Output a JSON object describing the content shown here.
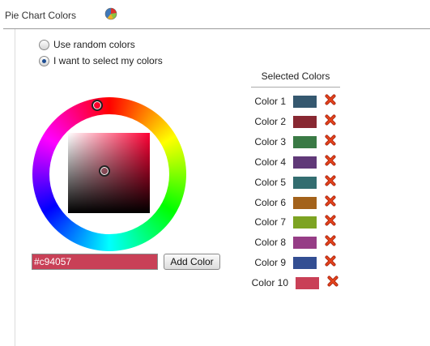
{
  "section": {
    "title": "Pie Chart Colors",
    "icon": "pie-chart-icon"
  },
  "color_mode": {
    "options": [
      {
        "label": "Use random colors",
        "checked": false
      },
      {
        "label": "I want to select my colors",
        "checked": true
      }
    ]
  },
  "picker": {
    "hex_value": "#c94057",
    "add_label": "Add Color"
  },
  "selected": {
    "header": "Selected Colors",
    "remove_icon": "remove-x-icon",
    "items": [
      {
        "label": "Color 1",
        "color": "#35586f"
      },
      {
        "label": "Color 2",
        "color": "#882832"
      },
      {
        "label": "Color 3",
        "color": "#3a7a45"
      },
      {
        "label": "Color 4",
        "color": "#603978"
      },
      {
        "label": "Color 5",
        "color": "#336d70"
      },
      {
        "label": "Color 6",
        "color": "#a3621b"
      },
      {
        "label": "Color 7",
        "color": "#7da322"
      },
      {
        "label": "Color 8",
        "color": "#963d86"
      },
      {
        "label": "Color 9",
        "color": "#334e92"
      },
      {
        "label": "Color 10",
        "color": "#c94057"
      }
    ]
  }
}
